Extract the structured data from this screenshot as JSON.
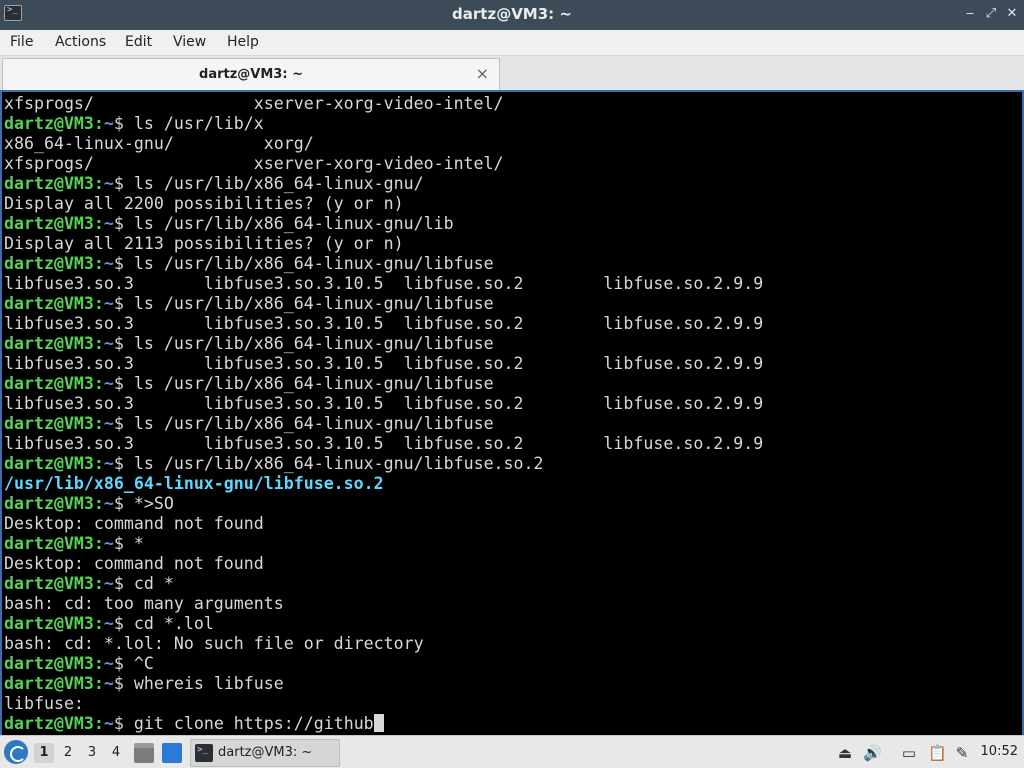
{
  "window": {
    "title": "dartz@VM3: ~",
    "minimize_glyph": "‒",
    "maximize_glyph": "⤢",
    "close_glyph": "✕"
  },
  "menu": [
    "File",
    "Actions",
    "Edit",
    "View",
    "Help"
  ],
  "tab": {
    "label": "dartz@VM3: ~",
    "close_glyph": "×"
  },
  "terminal": {
    "prompt_user": "dartz@VM3",
    "prompt_sep": ":",
    "prompt_path": "~",
    "prompt_sign": "$ ",
    "lines": [
      {
        "type": "out",
        "text": "xfsprogs/                xserver-xorg-video-intel/"
      },
      {
        "type": "cmd",
        "text": "ls /usr/lib/x"
      },
      {
        "type": "out",
        "text": "x86_64-linux-gnu/         xorg/"
      },
      {
        "type": "out",
        "text": "xfsprogs/                xserver-xorg-video-intel/"
      },
      {
        "type": "cmd",
        "text": "ls /usr/lib/x86_64-linux-gnu/"
      },
      {
        "type": "out",
        "text": "Display all 2200 possibilities? (y or n)"
      },
      {
        "type": "cmd",
        "text": "ls /usr/lib/x86_64-linux-gnu/lib"
      },
      {
        "type": "out",
        "text": "Display all 2113 possibilities? (y or n)"
      },
      {
        "type": "cmd",
        "text": "ls /usr/lib/x86_64-linux-gnu/libfuse"
      },
      {
        "type": "out",
        "text": "libfuse3.so.3       libfuse3.so.3.10.5  libfuse.so.2        libfuse.so.2.9.9"
      },
      {
        "type": "cmd",
        "text": "ls /usr/lib/x86_64-linux-gnu/libfuse"
      },
      {
        "type": "out",
        "text": "libfuse3.so.3       libfuse3.so.3.10.5  libfuse.so.2        libfuse.so.2.9.9"
      },
      {
        "type": "cmd",
        "text": "ls /usr/lib/x86_64-linux-gnu/libfuse"
      },
      {
        "type": "out",
        "text": "libfuse3.so.3       libfuse3.so.3.10.5  libfuse.so.2        libfuse.so.2.9.9"
      },
      {
        "type": "cmd",
        "text": "ls /usr/lib/x86_64-linux-gnu/libfuse"
      },
      {
        "type": "out",
        "text": "libfuse3.so.3       libfuse3.so.3.10.5  libfuse.so.2        libfuse.so.2.9.9"
      },
      {
        "type": "cmd",
        "text": "ls /usr/lib/x86_64-linux-gnu/libfuse"
      },
      {
        "type": "out",
        "text": "libfuse3.so.3       libfuse3.so.3.10.5  libfuse.so.2        libfuse.so.2.9.9"
      },
      {
        "type": "cmd",
        "text": "ls /usr/lib/x86_64-linux-gnu/libfuse.so.2"
      },
      {
        "type": "path",
        "text": "/usr/lib/x86_64-linux-gnu/libfuse.so.2"
      },
      {
        "type": "cmd",
        "text": "*>SO"
      },
      {
        "type": "out",
        "text": "Desktop: command not found"
      },
      {
        "type": "cmd",
        "text": "*"
      },
      {
        "type": "out",
        "text": "Desktop: command not found"
      },
      {
        "type": "cmd",
        "text": "cd *"
      },
      {
        "type": "out",
        "text": "bash: cd: too many arguments"
      },
      {
        "type": "cmd",
        "text": "cd *.lol"
      },
      {
        "type": "out",
        "text": "bash: cd: *.lol: No such file or directory"
      },
      {
        "type": "cmd",
        "text": "^C"
      },
      {
        "type": "cmd",
        "text": "whereis libfuse"
      },
      {
        "type": "out",
        "text": "libfuse:"
      },
      {
        "type": "cmd",
        "text": "git clone https://github",
        "cursor": true
      }
    ]
  },
  "taskbar": {
    "workspaces": [
      "1",
      "2",
      "3",
      "4"
    ],
    "active_workspace": "1",
    "task_label": "dartz@VM3: ~",
    "clock": "10:52",
    "icons": [
      "start-menu-icon",
      "file-manager-icon",
      "show-desktop-icon",
      "terminal-icon",
      "eject-icon",
      "volume-icon",
      "network-icon",
      "clipboard-icon",
      "notes-icon"
    ]
  }
}
